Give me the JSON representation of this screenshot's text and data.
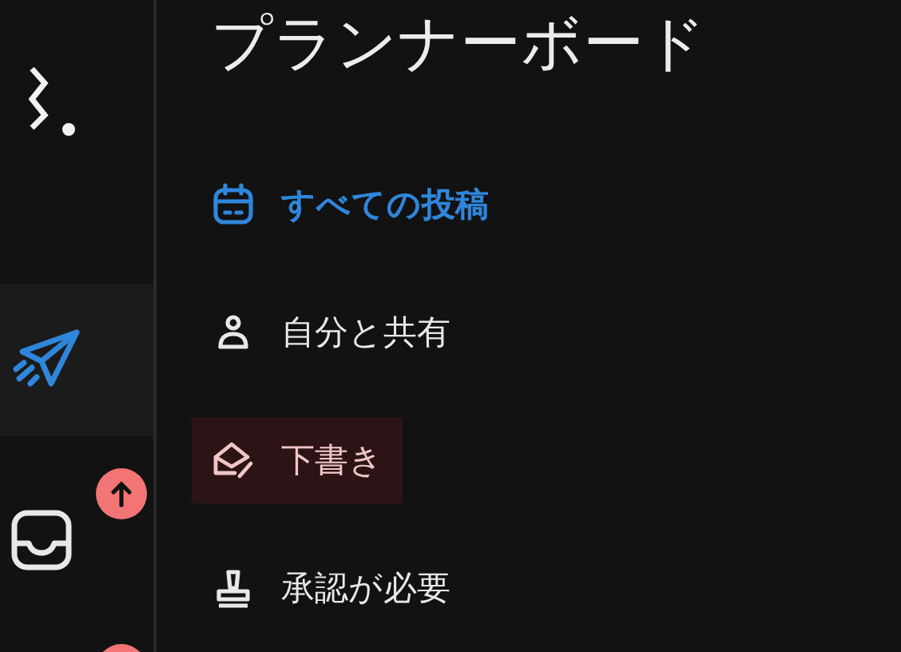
{
  "rail": [
    {
      "selected": true,
      "badge": false
    },
    {
      "selected": false,
      "badge": true
    },
    {
      "badge": true
    }
  ],
  "title": "プランナーボード",
  "menu": [
    {
      "label": "すべての投稿",
      "selected": true,
      "highlighted": false
    },
    {
      "label": "自分と共有",
      "selected": false,
      "highlighted": false
    },
    {
      "label": "下書き",
      "selected": false,
      "highlighted": true
    },
    {
      "label": "承認が必要",
      "selected": false,
      "highlighted": false
    }
  ]
}
